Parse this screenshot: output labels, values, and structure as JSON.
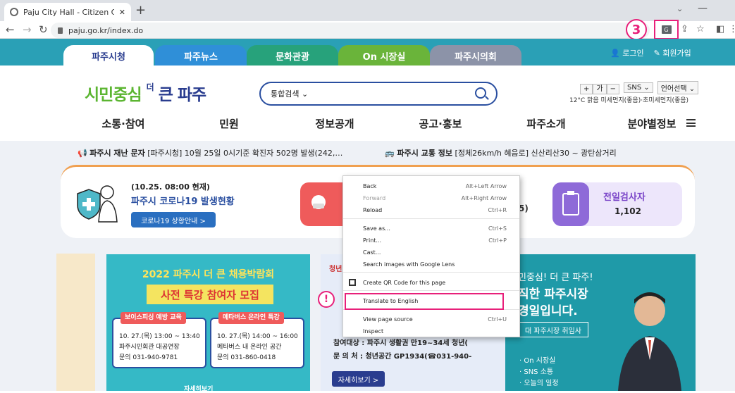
{
  "browser": {
    "tab_title": "Paju City Hall - Citizen Center | ",
    "new_tab": "+",
    "tab_menu": "⌄",
    "minimize": "—",
    "url": "paju.go.kr/index.do",
    "back": "←",
    "forward": "→",
    "reload": "↻",
    "share": "⇪",
    "star": "☆",
    "sidepanel": "◧",
    "menu": "⋮",
    "annotation": "3"
  },
  "gnb": {
    "tabs": [
      "파주시청",
      "파주뉴스",
      "문화관광",
      "On 시장실",
      "파주시의회"
    ],
    "login": "로그인",
    "signup": "회원가입"
  },
  "header": {
    "logo_a": "시민중심",
    "logo_b": "더",
    "logo_c": "큰 파주",
    "search_scope": "통합검색",
    "font_plus": "+",
    "font_label": "가",
    "font_minus": "−",
    "sns": "SNS",
    "lang": "언어선택",
    "weather": "12°C 맑음 미세먼지(좋음)·초미세먼지(좋음)"
  },
  "menu": [
    "소통·참여",
    "민원",
    "정보공개",
    "공고·홍보",
    "파주소개",
    "분야별정보"
  ],
  "ticker": {
    "disaster_label": "파주시 재난 문자",
    "disaster_text": "[파주시청] 10월 25일 0시기준 확진자 502명 발생(242,…",
    "traffic_label": "파주시 교통 정보",
    "traffic_text": "[정체26km/h 혜음로] 신산리산30 ~ 광탄삼거리"
  },
  "covid": {
    "meta": "(10.25. 08:00 현재)",
    "title": "파주시 코로나19 발생현황",
    "button": "코로나19 상황안내 >",
    "partial_value": "5)",
    "test_label": "전일검사자",
    "test_value": "1,102"
  },
  "banner1": {
    "title": "2022 파주시 더 큰 채용박람회",
    "subtitle": "사전 특강 참여자 모집",
    "box1": {
      "head": "보이스피싱 예방 교육",
      "time": "10. 27.(목) 13:00 ~ 13:40",
      "place": "파주시민회관 대공연장",
      "contact": "문의 031-940-9781"
    },
    "box2": {
      "head": "메타버스 온라인 특강",
      "time": "10. 27.(목) 14:00 ~ 16:00",
      "place": "메타버스 내 온라인 공간",
      "contact": "문의 031-860-0418"
    },
    "footer": "자세히보기"
  },
  "banner2": {
    "label": "청년",
    "target": "참여대상 : 파주시 생활권 만19~34세 청년(",
    "contact": "문 의 처 : 청년공간 GP1934(☎031-940-",
    "button": "자세히보기 >",
    "annotation": "!"
  },
  "banner3": {
    "line1": "민중심! 더 큰 파주!",
    "line2": "직한 파주시장",
    "line3": "경일입니다.",
    "button": "대 파주시장 취임사",
    "list": [
      "· On 시장실",
      "· SNS 소통",
      "· 오늘의 일정"
    ]
  },
  "context_menu": {
    "items": [
      {
        "label": "Back",
        "key": "Alt+Left Arrow",
        "disabled": false
      },
      {
        "label": "Forward",
        "key": "Alt+Right Arrow",
        "disabled": true
      },
      {
        "label": "Reload",
        "key": "Ctrl+R",
        "disabled": false
      },
      {
        "label": "Save as...",
        "key": "Ctrl+S",
        "disabled": false
      },
      {
        "label": "Print...",
        "key": "Ctrl+P",
        "disabled": false
      },
      {
        "label": "Cast...",
        "key": "",
        "disabled": false
      },
      {
        "label": "Search images with Google Lens",
        "key": "",
        "disabled": false
      },
      {
        "label": "Create QR Code for this page",
        "key": "",
        "disabled": false
      },
      {
        "label": "Translate to English",
        "key": "",
        "disabled": false
      },
      {
        "label": "View page source",
        "key": "Ctrl+U",
        "disabled": false
      },
      {
        "label": "Inspect",
        "key": "",
        "disabled": false
      }
    ]
  },
  "colors": {
    "accent": "#2aa0b6",
    "highlight": "#e8207a",
    "brand_navy": "#2a3d8f"
  }
}
